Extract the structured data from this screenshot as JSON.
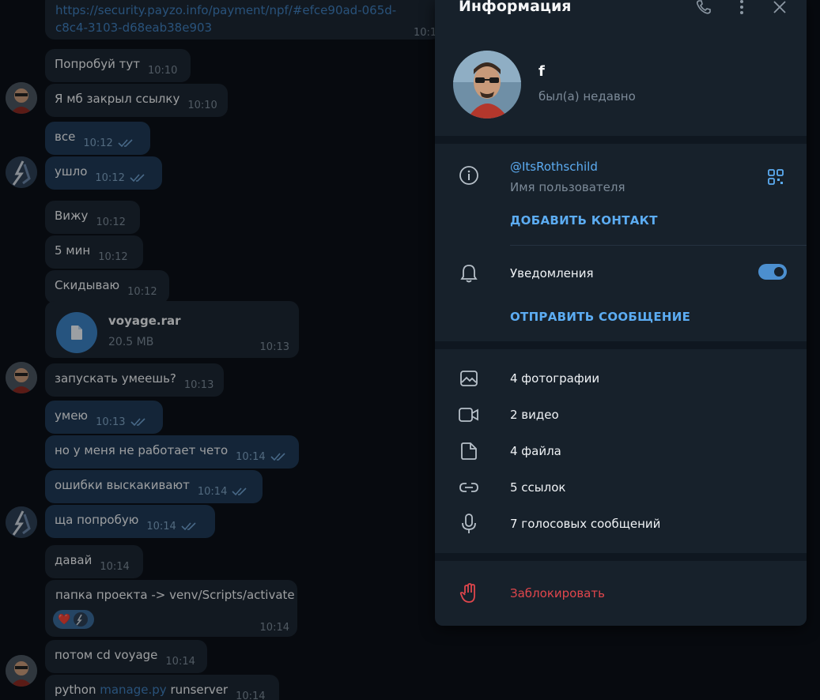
{
  "chat": {
    "link_line1": "https://security.payzo.info/payment/npf/#efce90ad-065d-",
    "link_line2": "c8c4-3103-d68eab38e903",
    "link_time": "10:1",
    "messages": [
      {
        "text": "Попробуй тут",
        "time": "10:10"
      },
      {
        "text": "Я мб закрыл ссылку",
        "time": "10:10"
      },
      {
        "text": "все",
        "time": "10:12"
      },
      {
        "text": "ушло",
        "time": "10:12"
      },
      {
        "text": "Вижу",
        "time": "10:12"
      },
      {
        "text": "5 мин",
        "time": "10:12"
      },
      {
        "text": "Скидываю",
        "time": "10:12"
      },
      {
        "text": "запускать умеешь?",
        "time": "10:13"
      },
      {
        "text": "умею",
        "time": "10:13"
      },
      {
        "text": "но у меня не работает чето",
        "time": "10:14"
      },
      {
        "text": "ошибки выскакивают",
        "time": "10:14"
      },
      {
        "text": "ща попробую",
        "time": "10:14"
      },
      {
        "text": "давай",
        "time": "10:14"
      },
      {
        "text": "папка проекта -> venv/Scripts/activate",
        "time": "10:14"
      },
      {
        "text": "потом cd voyage",
        "time": "10:14"
      },
      {
        "text_pre": "python ",
        "text_link": "manage.py",
        "text_post": " runserver",
        "time": "10:14"
      }
    ],
    "file": {
      "name": "voyage.rar",
      "size": "20.5 MB",
      "time": "10:13"
    },
    "reaction": "❤️"
  },
  "panel": {
    "title": "Информация",
    "name": "f",
    "status": "был(а) недавно",
    "username": "@ItsRothschild",
    "username_label": "Имя пользователя",
    "add_contact": "ДОБАВИТЬ КОНТАКТ",
    "notifications": "Уведомления",
    "notifications_on": true,
    "send_message": "ОТПРАВИТЬ СООБЩЕНИЕ",
    "media": [
      {
        "icon": "photo-icon",
        "label": "4 фотографии"
      },
      {
        "icon": "video-icon",
        "label": "2 видео"
      },
      {
        "icon": "file-icon",
        "label": "4 файла"
      },
      {
        "icon": "link-icon",
        "label": "5 ссылок"
      },
      {
        "icon": "mic-icon",
        "label": "7 голосовых сообщений"
      }
    ],
    "block": "Заблокировать"
  },
  "colors": {
    "accent": "#5cacf2",
    "danger": "#e0464c",
    "panel_bg": "#17212b",
    "incoming_bubble": "#1d2733",
    "outgoing_bubble": "#1f3a56"
  }
}
